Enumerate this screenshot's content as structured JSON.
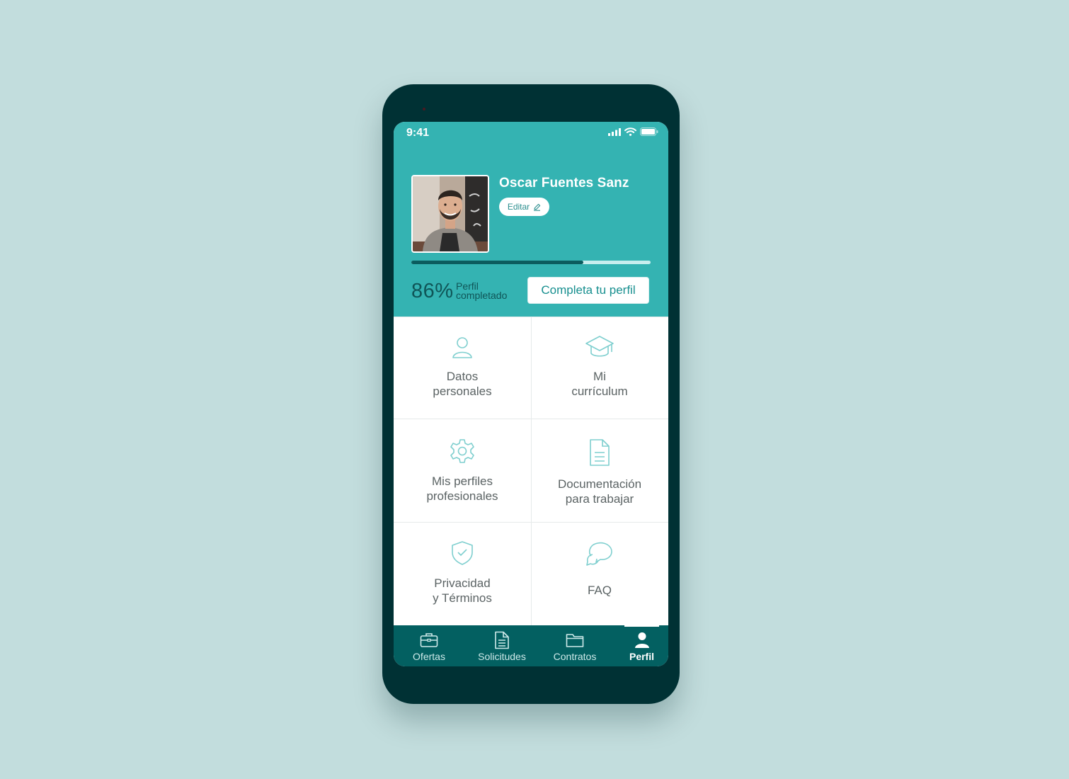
{
  "status_bar": {
    "time": "9:41"
  },
  "profile": {
    "name": "Oscar Fuentes Sanz",
    "edit_label": "Editar",
    "progress": 0.72,
    "percent_text": "86%",
    "percent_label": "Perfil completado",
    "complete_button": "Completa tu perfil"
  },
  "menu": [
    {
      "label": "Datos\npersonales",
      "icon": "user-icon"
    },
    {
      "label": "Mi\ncurrículum",
      "icon": "graduation-cap-icon"
    },
    {
      "label": "Mis perfiles\nprofesionales",
      "icon": "gear-icon"
    },
    {
      "label": "Documentación\npara trabajar",
      "icon": "document-icon"
    },
    {
      "label": "Privacidad\ny Términos",
      "icon": "shield-check-icon"
    },
    {
      "label": "FAQ",
      "icon": "chat-bubbles-icon"
    }
  ],
  "tabs": [
    {
      "label": "Ofertas",
      "icon": "briefcase-icon"
    },
    {
      "label": "Solicitudes",
      "icon": "document-icon"
    },
    {
      "label": "Contratos",
      "icon": "folder-icon"
    },
    {
      "label": "Perfil",
      "icon": "user-icon",
      "active": true
    }
  ],
  "colors": {
    "background": "#c2dddd",
    "phone_frame": "#003134",
    "header": "#34b3b2",
    "tab_bar": "#036061",
    "icon_tint": "#7fcfcf"
  }
}
